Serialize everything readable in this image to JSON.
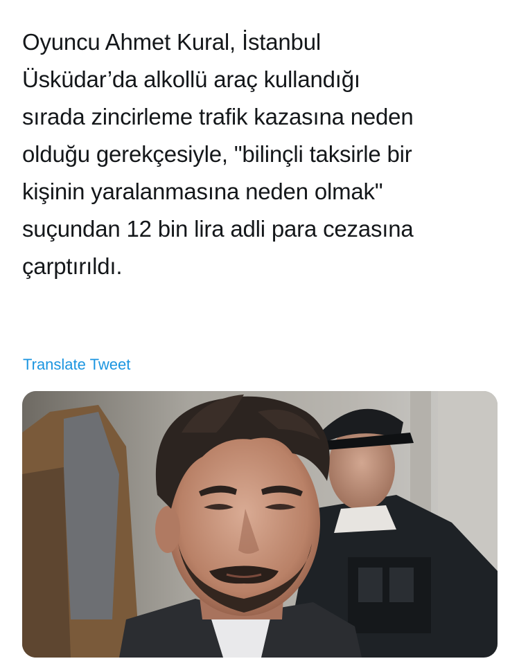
{
  "tweet": {
    "text": "Oyuncu Ahmet Kural, İstanbul\nÜsküdar’da alkollü araç kullandığı\nsırada zincirleme trafik kazasına neden\nolduğu gerekçesiyle, \"bilinçli taksirle bir\nkişinin yaralanmasına neden olmak\"\nsuçundan 12 bin lira adli para cezasına\nçarptırıldı.",
    "translate_label": "Translate Tweet"
  },
  "media": {
    "type": "photo",
    "description_icon": "photo-man-portrait"
  },
  "colors": {
    "text": "#14171a",
    "link": "#1b95e0",
    "background": "#ffffff"
  }
}
